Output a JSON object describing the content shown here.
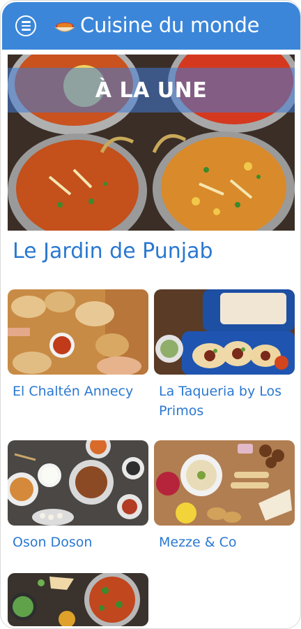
{
  "app": {
    "title": "Cuisine du monde"
  },
  "featured": {
    "banner": "À LA UNE",
    "name": "Le Jardin de Punjab"
  },
  "restaurants": [
    {
      "name": "El Chaltén Annecy"
    },
    {
      "name": "La Taqueria by Los Primos"
    },
    {
      "name": "Oson Doson"
    },
    {
      "name": "Mezze & Co"
    },
    {
      "name": ""
    }
  ],
  "colors": {
    "appbar": "#3b86d9",
    "accent_text": "#2a78d1",
    "banner": "#407cd6"
  },
  "icons": [
    "menu-icon",
    "food-bowl-logo-icon"
  ]
}
